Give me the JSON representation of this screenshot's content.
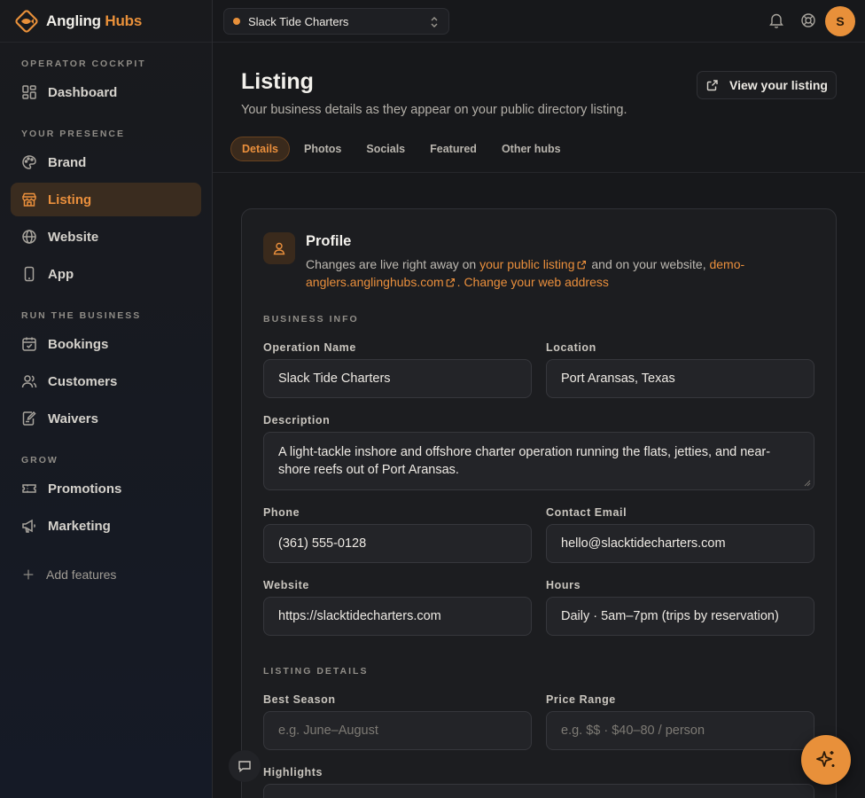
{
  "brand": {
    "name_part1": "Angling",
    "name_part2": "Hubs",
    "accent": "#e8903a"
  },
  "sidebar": {
    "sections": [
      {
        "label": "OPERATOR COCKPIT"
      },
      {
        "label": "YOUR PRESENCE"
      },
      {
        "label": "RUN THE BUSINESS"
      },
      {
        "label": "GROW"
      }
    ],
    "items": [
      {
        "label": "Dashboard",
        "icon": "dashboard-icon"
      },
      {
        "label": "Brand",
        "icon": "palette-icon"
      },
      {
        "label": "Listing",
        "icon": "store-icon",
        "active": true
      },
      {
        "label": "Website",
        "icon": "globe-icon"
      },
      {
        "label": "App",
        "icon": "phone-icon"
      },
      {
        "label": "Bookings",
        "icon": "calendar-icon"
      },
      {
        "label": "Customers",
        "icon": "users-icon"
      },
      {
        "label": "Waivers",
        "icon": "waiver-icon"
      },
      {
        "label": "Promotions",
        "icon": "ticket-icon"
      },
      {
        "label": "Marketing",
        "icon": "megaphone-icon"
      }
    ],
    "add_features": "Add features"
  },
  "topbar": {
    "org_name": "Slack Tide Charters",
    "avatar_initial": "S"
  },
  "page": {
    "title": "Listing",
    "subtitle": "Your business details as they appear on your public directory listing.",
    "view_button": "View your listing",
    "tabs": [
      "Details",
      "Photos",
      "Socials",
      "Featured",
      "Other hubs"
    ]
  },
  "profile": {
    "title": "Profile",
    "desc_1": "Changes are live right away on ",
    "link_1": "your public listing",
    "desc_2": " and on your website, ",
    "link_2": "demo-anglers.anglinghubs.com",
    "desc_3": ". ",
    "link_3": "Change your web address"
  },
  "business_info": {
    "label": "BUSINESS INFO",
    "operation_name_label": "Operation Name",
    "operation_name": "Slack Tide Charters",
    "location_label": "Location",
    "location": "Port Aransas, Texas",
    "description_label": "Description",
    "description": "A light-tackle inshore and offshore charter operation running the flats, jetties, and near-shore reefs out of Port Aransas.",
    "phone_label": "Phone",
    "phone": "(361) 555-0128",
    "email_label": "Contact Email",
    "email": "hello@slacktidecharters.com",
    "website_label": "Website",
    "website": "https://slacktidecharters.com",
    "hours_label": "Hours",
    "hours": "Daily · 5am–7pm (trips by reservation)"
  },
  "listing_details": {
    "label": "LISTING DETAILS",
    "season_label": "Best Season",
    "season_placeholder": "e.g. June–August",
    "price_label": "Price Range",
    "price_placeholder": "e.g. $$ · $40–80 / person",
    "highlights_label": "Highlights"
  }
}
